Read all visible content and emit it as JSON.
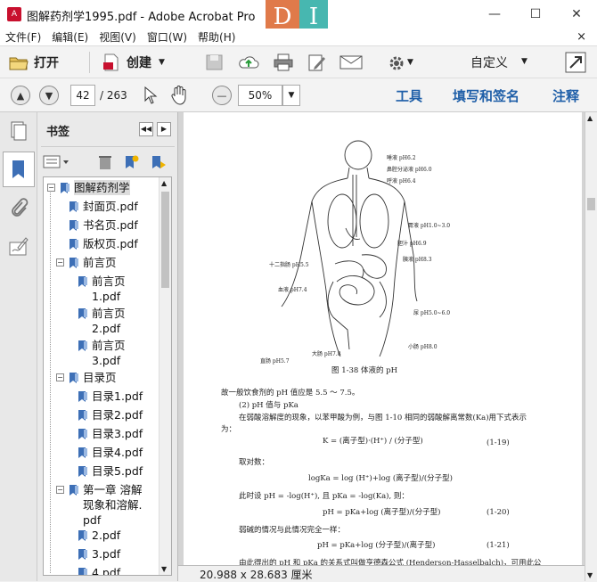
{
  "window": {
    "title": "图解药剂学1995.pdf - Adobe Acrobat Pro",
    "minimize": "—",
    "maximize": "☐",
    "close": "✕",
    "tile_left": "D",
    "tile_right": "I"
  },
  "menu": [
    "文件(F)",
    "编辑(E)",
    "视图(V)",
    "窗口(W)",
    "帮助(H)"
  ],
  "menu_close": "×",
  "toolbar": {
    "open": "打开",
    "create": "创建",
    "customize": "自定义"
  },
  "nav": {
    "page_value": "42",
    "page_total": "/ 263",
    "zoom": "50%",
    "tools": "工具",
    "fill_sign": "填写和签名",
    "comment": "注释"
  },
  "bookmarks": {
    "header": "书签",
    "items": [
      {
        "label": "图解药剂学",
        "expanded": true
      },
      {
        "label": "封面页.pdf"
      },
      {
        "label": "书名页.pdf"
      },
      {
        "label": "版权页.pdf"
      },
      {
        "label": "前言页",
        "expanded": true
      },
      {
        "label": "前言页",
        "label2": "1.pdf"
      },
      {
        "label": "前言页",
        "label2": "2.pdf"
      },
      {
        "label": "前言页",
        "label2": "3.pdf"
      },
      {
        "label": "目录页",
        "expanded": true
      },
      {
        "label": "目录1.pdf"
      },
      {
        "label": "目录2.pdf"
      },
      {
        "label": "目录3.pdf"
      },
      {
        "label": "目录4.pdf"
      },
      {
        "label": "目录5.pdf"
      },
      {
        "label": "第一章 溶解",
        "label2": "现象和溶解.",
        "label3": "pdf",
        "expanded": true
      },
      {
        "label": "2.pdf"
      },
      {
        "label": "3.pdf"
      },
      {
        "label": "4.pdf"
      }
    ]
  },
  "document": {
    "figure_labels": [
      "唾液 pH6.2",
      "鼻腔分泌液 pH6.0",
      "呼液 pH6.4",
      "胃液 pH1.0~3.0",
      "胆汁 pH6.9",
      "胰液 pH8.3",
      "十二指肠 pH5.5",
      "血液 pH7.4",
      "尿 pH5.0~6.0",
      "小肠 pH8.0",
      "大肠 pH7.8",
      "直肠 pH5.7"
    ],
    "figure_caption": "图 1-38  体液的 pH",
    "para1": "故一般饮食剂的 pH 值应是 5.5 ～ 7.5。",
    "heading": "(2) pH 值与 pKa",
    "para2a": "在弱酸溶解度的现象，以苯甲酸为例，与图 1-10 相同的弱酸解离常数(Ka)用下式表示",
    "para2b": "为：",
    "eq19": "K = (离子型)·(H⁺) / (分子型)",
    "eq19n": "(1-19)",
    "log_intro": "取对数：",
    "eq_log": "logKa = log (H⁺)+log (离子型)/(分子型)",
    "para3": "此时设 pH = -log(H⁺), 且 pKa = -log(Ka), 则：",
    "eq20": "pH = pKa+log (离子型)/(分子型)",
    "eq20n": "(1-20)",
    "para4": "弱碱的情况与此情况完全一样：",
    "eq21": "pH = pKa+log (分子型)/(离子型)",
    "eq21n": "(1-21)",
    "para5": "由此得出的 pH 和 pKa 的关系式叫做亨德森公式 (Henderson-Hasselbalch)，可用此公"
  },
  "statusbar": {
    "size": "20.988 x 28.683 厘米"
  },
  "colors": {
    "accent_link": "#1f5fa8",
    "tile_orange": "#e07a4a",
    "tile_teal": "#47b7b0",
    "bookmark_icon": "#3d6fb6"
  }
}
